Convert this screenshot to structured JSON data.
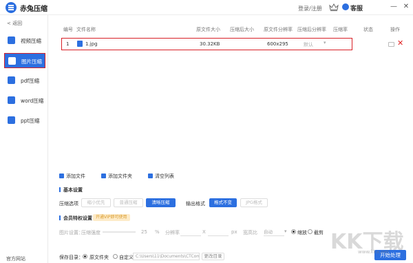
{
  "app": {
    "title": "赤兔压缩",
    "login": "登录/注册",
    "service": "客服"
  },
  "window_controls": [
    "—",
    "✕"
  ],
  "sidebar": {
    "back": "< 返回",
    "items": [
      {
        "label": "视频压缩",
        "icon": "video-icon",
        "color": "#2c6fe0"
      },
      {
        "label": "图片压缩",
        "icon": "image-icon",
        "color": "#2c6fe0",
        "active": true
      },
      {
        "label": "pdf压缩",
        "icon": "pdf-icon",
        "color": "#2c6fe0"
      },
      {
        "label": "word压缩",
        "icon": "word-icon",
        "color": "#2c6fe0"
      },
      {
        "label": "ppt压缩",
        "icon": "ppt-icon",
        "color": "#2c6fe0"
      }
    ],
    "official": "官方网站"
  },
  "table": {
    "headers": [
      "编号",
      "文件名称",
      "原文件大小",
      "压缩后大小",
      "原文件分辨率",
      "压缩后分辨率",
      "压缩率",
      "状态",
      "操作"
    ],
    "rows": [
      {
        "index": "1",
        "name": "1.jpg",
        "orig_size": "30.32KB",
        "comp_size": "",
        "orig_res": "600x295",
        "comp_res": "默认",
        "rate": "",
        "status": ""
      }
    ]
  },
  "actions": {
    "add_file": "添加文件",
    "add_folder": "添加文件夹",
    "clear": "清空列表"
  },
  "basic": {
    "title": "基本设置",
    "compress_option_label": "压缩选项",
    "options": [
      "缩小优先",
      "普通压缩",
      "清晰压缩"
    ],
    "output_label": "输出格式",
    "formats": [
      "格式不变",
      "JPG格式"
    ]
  },
  "member": {
    "title": "会员特权设置",
    "vip_tag": "开通VIP即可使用",
    "image_settings": "图片设置：",
    "strength": "压缩强度",
    "strength_value": "25",
    "percent": "%",
    "resolution": "分辨率",
    "x": "X",
    "px": "px",
    "aspect": "宽高比",
    "auto": "自动",
    "scale": "缩放",
    "crop": "截剪"
  },
  "save": {
    "label": "保存目录：",
    "original": "原文件夹",
    "custom": "自定义",
    "path": "C:\\Users\\11\\Documents\\CTCom",
    "change": "更改目录"
  },
  "start": "开始处理",
  "watermark": "KK下载",
  "watermark_url": "www.kkx.net"
}
